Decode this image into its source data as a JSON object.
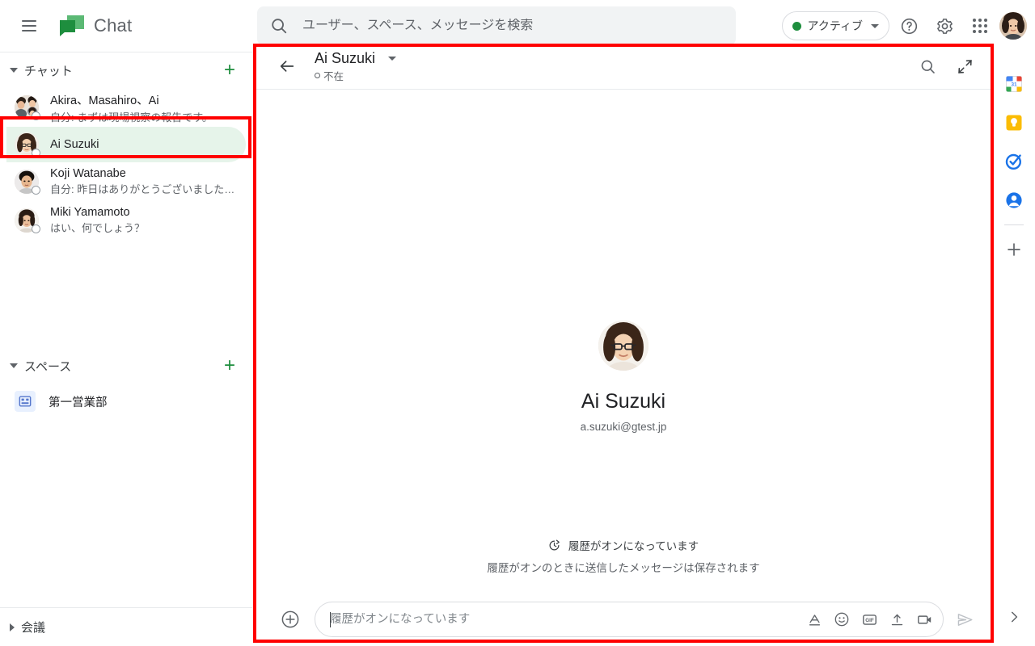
{
  "app": {
    "name": "Chat",
    "logo_colors": {
      "dark_green": "#1e8e3e",
      "light_green": "#5bb974"
    }
  },
  "topbar": {
    "menu_label": "メインメニュー",
    "search": {
      "placeholder": "ユーザー、スペース、メッセージを検索",
      "value": ""
    },
    "status": {
      "label": "アクティブ",
      "color": "#1e8e3e"
    },
    "help_label": "ヘルプ",
    "settings_label": "設定",
    "apps_label": "Google アプリ",
    "account_label": "Google アカウント"
  },
  "sidebar": {
    "chat_section": {
      "title": "チャット",
      "add_label": "+",
      "expanded": true,
      "items": [
        {
          "name": "Akira、Masahiro、Ai",
          "snippet": "自分: まずは現場視察の報告です。",
          "selected": false,
          "presence": "away"
        },
        {
          "name": "Ai Suzuki",
          "snippet": "",
          "selected": true,
          "presence": "away"
        },
        {
          "name": "Koji Watanabe",
          "snippet": "自分: 昨日はありがとうございました…",
          "selected": false,
          "presence": "away"
        },
        {
          "name": "Miki Yamamoto",
          "snippet": "はい、何でしょう？",
          "selected": false,
          "presence": "away"
        }
      ]
    },
    "spaces_section": {
      "title": "スペース",
      "add_label": "+",
      "expanded": true,
      "items": [
        {
          "name": "第一営業部",
          "icon": "space-icon"
        }
      ]
    },
    "meetings_section": {
      "title": "会議",
      "expanded": false
    },
    "selected_highlight_color": "#e6f4ea"
  },
  "conversation": {
    "back_label": "戻る",
    "title": "Ai Suzuki",
    "status": "不在",
    "search_label": "会話内を検索",
    "collapse_label": "全画面表示を終了",
    "profile": {
      "name": "Ai Suzuki",
      "email": "a.suzuki@gtest.jp"
    },
    "history": {
      "line1": "履歴がオンになっています",
      "line2": "履歴がオンのときに送信したメッセージは保存されます"
    },
    "composer": {
      "add_label": "統合機能を追加",
      "placeholder": "履歴がオンになっています",
      "value": "",
      "icons": [
        {
          "name": "format-icon",
          "label": "書式設定オプション"
        },
        {
          "name": "emoji-icon",
          "label": "絵文字を挿入"
        },
        {
          "name": "gif-icon",
          "label": "GIF を挿入"
        },
        {
          "name": "upload-icon",
          "label": "ファイルをアップロード"
        },
        {
          "name": "video-icon",
          "label": "ビデオ会議"
        }
      ],
      "send_label": "送信"
    }
  },
  "rail": {
    "items": [
      {
        "name": "calendar-icon",
        "label": "カレンダー",
        "badge": "31"
      },
      {
        "name": "keep-icon",
        "label": "Keep"
      },
      {
        "name": "tasks-icon",
        "label": "ToDo リスト"
      },
      {
        "name": "contacts-icon",
        "label": "連絡先"
      }
    ],
    "add_label": "アドオンを取得",
    "expand_label": "サイドパネルを開く"
  },
  "annotations": {
    "border_color": "#ff0000",
    "regions": [
      {
        "name": "conversation-panel-highlight"
      },
      {
        "name": "chat-list-item-highlight"
      }
    ]
  }
}
